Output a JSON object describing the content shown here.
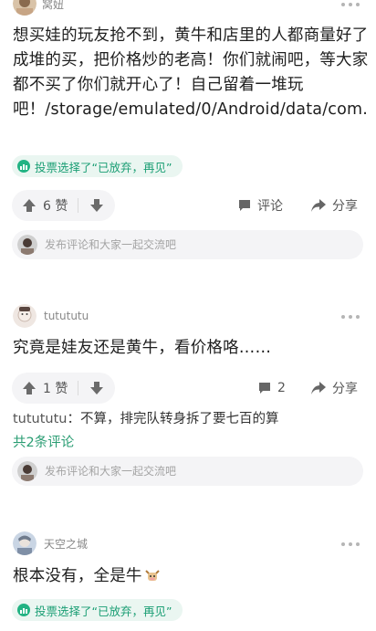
{
  "posts": [
    {
      "username": "窝妞",
      "body": "想买娃的玩友抢不到，黄牛和店里的人都商量好了成堆的买，把价格炒的老高！你们就闹吧，等大家都不买了你们就开心了！自己留着一堆玩吧！/storage/emulated/0/Android/data/com.",
      "vote_tag": "投票选择了“已放弃，再见”",
      "like_label": "6 赞",
      "comment_label": "评论",
      "share_label": "分享",
      "reply_placeholder": "发布评论和大家一起交流吧"
    },
    {
      "username": "tutututu",
      "body": "究竟是娃友还是黄牛，看价格咯……",
      "like_label": "1 赞",
      "comment_count": "2",
      "share_label": "分享",
      "sub_comment_name": "tutututu",
      "sub_comment_text": "：不算，排完队转身拆了要七百的算",
      "sub_comment_total": "共2条评论",
      "reply_placeholder": "发布评论和大家一起交流吧"
    },
    {
      "username": "天空之城",
      "body": "根本没有，全是牛",
      "vote_tag": "投票选择了“已放弃，再见”"
    }
  ],
  "colors": {
    "accent_green": "#1a9e74",
    "vote_bg": "#eaf6f1",
    "pill_bg": "#f4f4f6"
  },
  "icons": [
    "thumb-up-icon",
    "thumb-down-icon",
    "comment-icon",
    "share-icon",
    "more-icon",
    "vote-icon",
    "ox-emoji-icon"
  ]
}
